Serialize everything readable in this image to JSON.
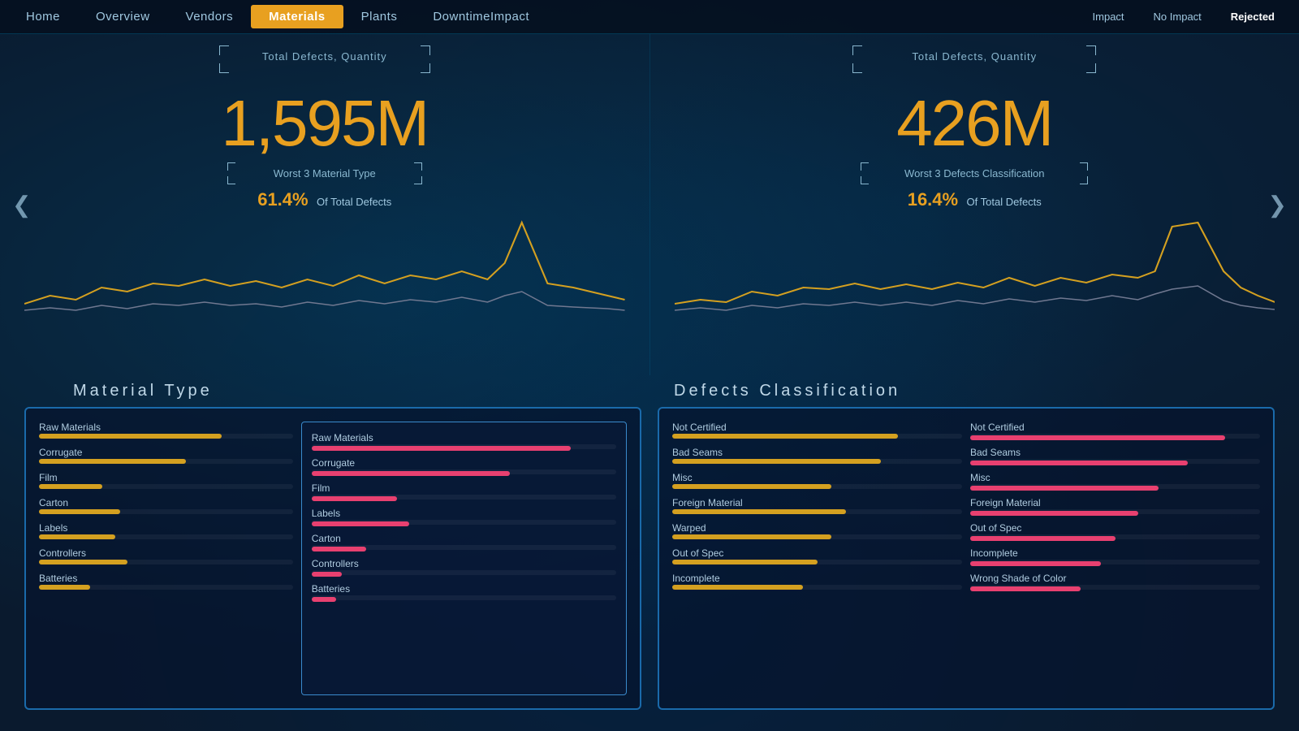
{
  "topbar": {
    "filter_impact": "Impact",
    "filter_no_impact": "No Impact",
    "filter_rejected": "Rejected",
    "nav": [
      {
        "label": "Home",
        "active": false
      },
      {
        "label": "Overview",
        "active": false
      },
      {
        "label": "Vendors",
        "active": false
      },
      {
        "label": "Materials",
        "active": true
      },
      {
        "label": "Plants",
        "active": false
      },
      {
        "label": "DowntimeImpact",
        "active": false
      }
    ]
  },
  "left_chart": {
    "title": "Total Defects, Quantity",
    "big_number": "1,595M",
    "sub_label": "Worst 3 Material Type",
    "percent_value": "61.4%",
    "percent_label": "Of Total Defects"
  },
  "right_chart": {
    "title": "Total Defects, Quantity",
    "big_number": "426M",
    "sub_label": "Worst 3 Defects Classification",
    "percent_value": "16.4%",
    "percent_label": "Of Total Defects"
  },
  "section_label_left": "Material Type",
  "section_label_right": "Defects Classification",
  "left_panel": {
    "outer_items": [
      {
        "label": "Raw Materials",
        "yellow_pct": 72,
        "pink_pct": 0
      },
      {
        "label": "Corrugate",
        "yellow_pct": 58,
        "pink_pct": 0
      },
      {
        "label": "Film",
        "yellow_pct": 25,
        "pink_pct": 0
      },
      {
        "label": "Carton",
        "yellow_pct": 32,
        "pink_pct": 0
      },
      {
        "label": "Labels",
        "yellow_pct": 30,
        "pink_pct": 0
      },
      {
        "label": "Controllers",
        "yellow_pct": 35,
        "pink_pct": 0
      },
      {
        "label": "Batteries",
        "yellow_pct": 20,
        "pink_pct": 0
      }
    ],
    "inner_items": [
      {
        "label": "Raw Materials",
        "yellow_pct": 0,
        "pink_pct": 85
      },
      {
        "label": "Corrugate",
        "yellow_pct": 0,
        "pink_pct": 65
      },
      {
        "label": "Film",
        "yellow_pct": 0,
        "pink_pct": 28
      },
      {
        "label": "Labels",
        "yellow_pct": 0,
        "pink_pct": 32
      },
      {
        "label": "Carton",
        "yellow_pct": 0,
        "pink_pct": 18
      },
      {
        "label": "Controllers",
        "yellow_pct": 0,
        "pink_pct": 10
      },
      {
        "label": "Batteries",
        "yellow_pct": 0,
        "pink_pct": 8
      }
    ]
  },
  "right_panel": {
    "left_items": [
      {
        "label": "Not Certified",
        "yellow_pct": 78,
        "pink_pct": 0
      },
      {
        "label": "Bad Seams",
        "yellow_pct": 72,
        "pink_pct": 0
      },
      {
        "label": "Misc",
        "yellow_pct": 55,
        "pink_pct": 0
      },
      {
        "label": "Foreign Material",
        "yellow_pct": 60,
        "pink_pct": 0
      },
      {
        "label": "Warped",
        "yellow_pct": 55,
        "pink_pct": 0
      },
      {
        "label": "Out of Spec",
        "yellow_pct": 50,
        "pink_pct": 0
      },
      {
        "label": "Incomplete",
        "yellow_pct": 45,
        "pink_pct": 0
      }
    ],
    "right_items": [
      {
        "label": "Not Certified",
        "yellow_pct": 0,
        "pink_pct": 88
      },
      {
        "label": "Bad Seams",
        "yellow_pct": 0,
        "pink_pct": 75
      },
      {
        "label": "Misc",
        "yellow_pct": 0,
        "pink_pct": 65
      },
      {
        "label": "Foreign Material",
        "yellow_pct": 0,
        "pink_pct": 58
      },
      {
        "label": "Out of Spec",
        "yellow_pct": 0,
        "pink_pct": 50
      },
      {
        "label": "Incomplete",
        "yellow_pct": 0,
        "pink_pct": 45
      },
      {
        "label": "Wrong Shade of Color",
        "yellow_pct": 0,
        "pink_pct": 38
      }
    ]
  },
  "nav_left": "❮",
  "nav_right": "❯"
}
